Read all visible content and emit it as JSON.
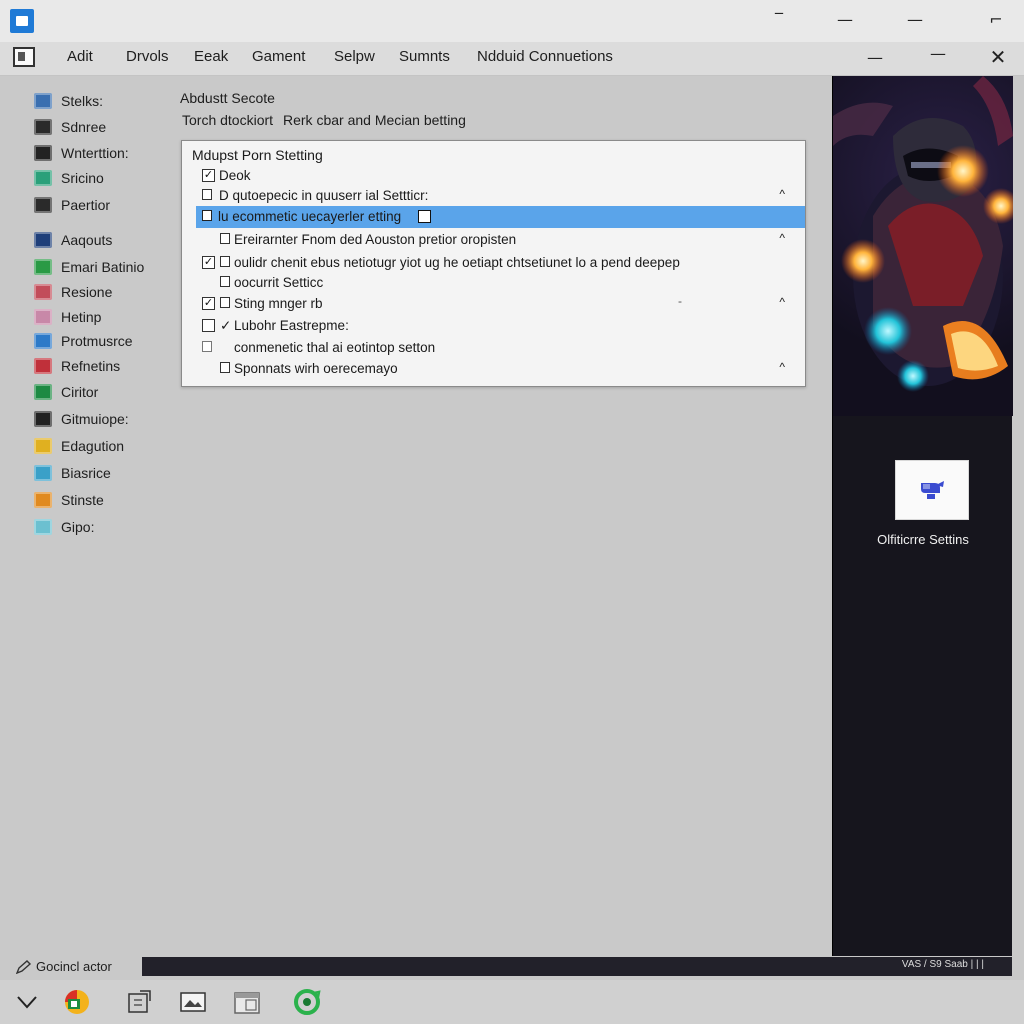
{
  "window": {
    "controls": [
      "‾",
      "—",
      "—",
      "⌐"
    ],
    "second_row_controls": [
      "—",
      "—",
      "✕"
    ]
  },
  "menu": {
    "items": [
      "Adit",
      "Drvols",
      "Eeak",
      "Gament",
      "Selpw",
      "Sumnts",
      "Ndduid Connuetions"
    ]
  },
  "sidebar": {
    "items": [
      {
        "label": "Stelks:",
        "icon": "monitor-icon",
        "color": "#3a6fb0"
      },
      {
        "label": "Sdnree",
        "icon": "grid-icon",
        "color": "#2a2a2a"
      },
      {
        "label": "Wnterttion:",
        "icon": "split-arrow-icon",
        "color": "#222222"
      },
      {
        "label": "Sricino",
        "icon": "landscape-icon",
        "color": "#2aa07a"
      },
      {
        "label": "Paertior",
        "icon": "film-icon",
        "color": "#2a2a2a"
      },
      {
        "label": "Aaqouts",
        "icon": "clipboard-icon",
        "color": "#1f3f7a"
      },
      {
        "label": "Emari Batinio",
        "icon": "home-icon",
        "color": "#2a9a45"
      },
      {
        "label": "Resione",
        "icon": "plus-icon",
        "color": "#c24d5a"
      },
      {
        "label": "Hetinp",
        "icon": "card-icon",
        "color": "#c888a8"
      },
      {
        "label": "Protmusrce",
        "icon": "bell-icon",
        "color": "#2d7ac8"
      },
      {
        "label": "Refnetins",
        "icon": "book-icon",
        "color": "#c0303a"
      },
      {
        "label": "Ciritor",
        "icon": "target-icon",
        "color": "#1d8a43"
      },
      {
        "label": "Gitmuiope:",
        "icon": "gamepad-icon",
        "color": "#222222"
      },
      {
        "label": "Edagution",
        "icon": "brush-icon",
        "color": "#e0b020"
      },
      {
        "label": "Biasrice",
        "icon": "palette-icon",
        "color": "#3aa0c8"
      },
      {
        "label": "Stinste",
        "icon": "sparkle-icon",
        "color": "#e08a20"
      },
      {
        "label": "Gipo:",
        "icon": "shield-icon",
        "color": "#6cc0d0"
      }
    ]
  },
  "main": {
    "heading": "Abdustt Secote",
    "subnav": [
      "Torch dtockiort",
      "Rerk cbar and Mecian betting"
    ]
  },
  "panel": {
    "title": "Mdupst Porn Stetting",
    "rows": [
      {
        "label": "Deok",
        "checked": "✓",
        "chevron": "",
        "selected": false
      },
      {
        "label": "D qutoepecic in quuserr ial Settticr:",
        "checked": "",
        "chevron": "^",
        "selected": false
      },
      {
        "label": "lu ecommetic uecayerler etting",
        "checked": "",
        "chevron": "",
        "selected": true
      },
      {
        "label": "Ereirarnter Fnom ded Aouston pretior oropisten",
        "checked": "",
        "chevron": "^",
        "selected": false
      },
      {
        "label": "oulidr chenit ebus netiotugr yiot ug he oetiapt chtsetiunet lo a pend deepep",
        "checked": "✓",
        "chevron": "",
        "selected": false
      },
      {
        "label": "oocurrit Setticc",
        "checked": "",
        "chevron": "",
        "selected": false
      },
      {
        "label": "Sting mnger rb",
        "checked": "✓",
        "chevron": "^",
        "selected": false
      },
      {
        "label": "Lubohr Eastrepme:",
        "checked": "✓",
        "chevron": "",
        "selected": false
      },
      {
        "label": "conmenetic thal ai eotintop setton",
        "checked": "",
        "chevron": "",
        "selected": false
      },
      {
        "label": "Sponnats wirh oerecemayo",
        "checked": "",
        "chevron": "^",
        "selected": false
      }
    ],
    "dash": "-"
  },
  "right_pane": {
    "tile_label": "Olfiticrre Settins",
    "accent": "#3a4bd0"
  },
  "status": {
    "left_text": "Gocincl actor",
    "right_text": "VAS  /  S9  Saab  |  |  |"
  },
  "colors": {
    "selection": "#5aa4ea",
    "window_bg": "#c9c9c9",
    "dark_pane": "#16151d"
  }
}
